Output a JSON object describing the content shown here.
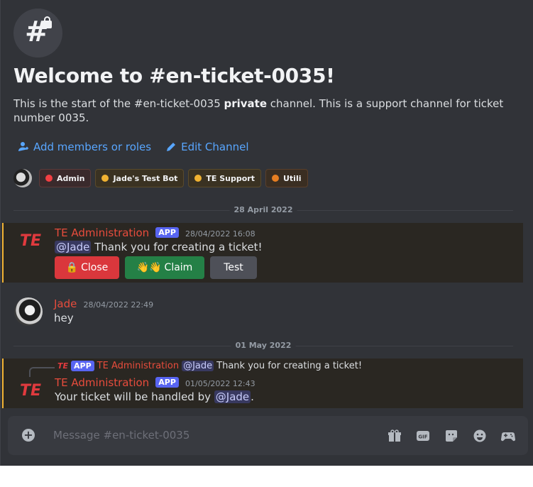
{
  "channel": {
    "welcome_title": "Welcome to #en-ticket-0035!",
    "intro_start": "This is the start of the #en-ticket-0035 ",
    "intro_bold": "private",
    "intro_end": " channel. This is a support channel for ticket number 0035."
  },
  "actions": {
    "add_members": "Add members or roles",
    "edit_channel": "Edit Channel"
  },
  "roles": [
    {
      "label": "Admin",
      "color": "#f23f43"
    },
    {
      "label": "Jade's Test Bot",
      "color": "#f0b232"
    },
    {
      "label": "TE Support",
      "color": "#f0b232"
    },
    {
      "label": "Utili",
      "color": "#e67e22"
    }
  ],
  "dividers": {
    "first": "28 April 2022",
    "second": "01 May 2022"
  },
  "messages": {
    "m1": {
      "author": "TE Administration",
      "tag": "APP",
      "timestamp": "28/04/2022 16:08",
      "mention": "@Jade",
      "text": " Thank you for creating a ticket!",
      "buttons": {
        "close": "Close",
        "claim": "Claim",
        "test": "Test"
      },
      "close_icon": "lock-emoji",
      "claim_icon": "wave-emoji"
    },
    "m2": {
      "author": "Jade",
      "timestamp": "28/04/2022 22:49",
      "text": "hey"
    },
    "m3": {
      "reply": {
        "tag": "APP",
        "author": "TE Administration",
        "mention": "@Jade",
        "text": "Thank you for creating a ticket!"
      },
      "author": "TE Administration",
      "tag": "APP",
      "timestamp": "01/05/2022 12:43",
      "text_start": "Your ticket will be handled by ",
      "mention": "@Jade",
      "text_end": "."
    }
  },
  "composer": {
    "placeholder": "Message #en-ticket-0035",
    "icons": [
      "gift-icon",
      "gif-icon",
      "sticker-icon",
      "emoji-icon",
      "game-controller-icon"
    ]
  },
  "colors": {
    "bg": "#313338",
    "link": "#58a6ff",
    "bot_name": "#e74c3c",
    "highlight_border": "#f0b232",
    "app_tag": "#5865f2"
  }
}
